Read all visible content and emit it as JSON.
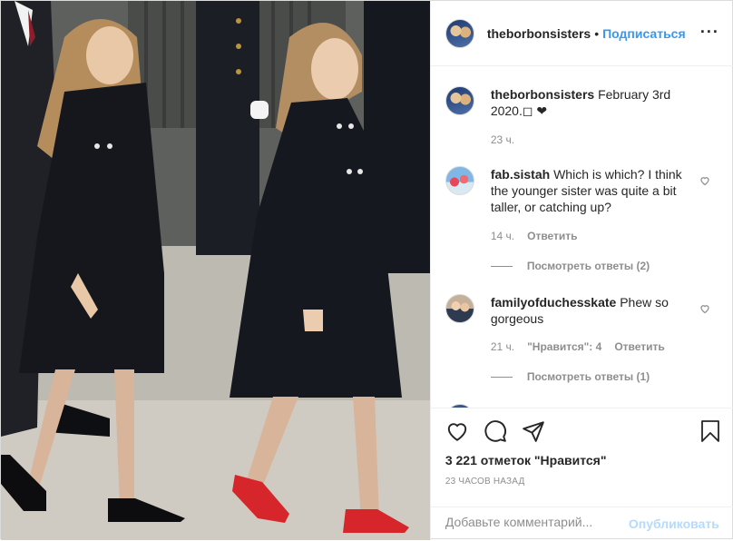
{
  "header": {
    "username": "theborbonsisters",
    "dot": "•",
    "follow_label": "Подписаться",
    "more_label": "···"
  },
  "caption": {
    "username": "theborbonsisters",
    "text": "February 3rd 2020.◻ ❤",
    "time": "23 ч."
  },
  "comments": [
    {
      "username": "fab.sistah",
      "text": "Which is which? I think the younger sister was quite a bit taller, or catching up?",
      "time": "14 ч.",
      "likes": "",
      "reply_label": "Ответить",
      "view_replies": "Посмотреть ответы (2)"
    },
    {
      "username": "familyofduchesskate",
      "text": "Phew so gorgeous",
      "time": "21 ч.",
      "likes": "\"Нравится\": 4",
      "reply_label": "Ответить",
      "view_replies": "Посмотреть ответы (1)"
    }
  ],
  "actions": {
    "likes": "3 221 отметок \"Нравится\"",
    "time_ago": "23 ЧАСОВ НАЗАД",
    "comment_placeholder": "Добавьте комментарий...",
    "publish_label": "Опубликовать"
  },
  "icons": {
    "like": "heart-icon",
    "comment": "comment-icon",
    "share": "share-icon",
    "save": "bookmark-icon",
    "comment_like": "small-heart-icon"
  },
  "colors": {
    "accent": "#3897f0",
    "publish_disabled": "#b3dbff",
    "muted": "#8e8e8e",
    "shoes": "#d7252c"
  }
}
